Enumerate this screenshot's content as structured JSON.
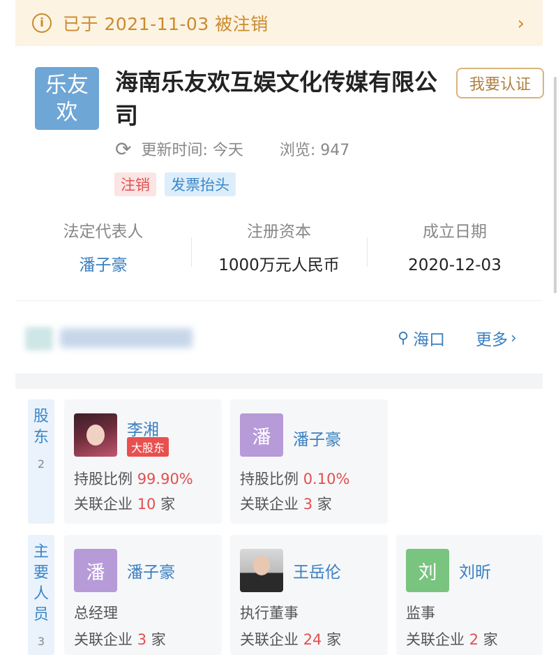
{
  "notice": {
    "text": "已于 2021-11-03 被注销",
    "info_icon": "i",
    "chevron": "›"
  },
  "company": {
    "logo_line1": "乐友",
    "logo_line2": "欢",
    "name": "海南乐友欢互娱文化传媒有限公司",
    "certify_label": "我要认证"
  },
  "meta": {
    "refresh_icon": "⟳",
    "updated": "更新时间: 今天",
    "views": "浏览: 947"
  },
  "tags": [
    "注销",
    "发票抬头"
  ],
  "basic_info": [
    {
      "label": "法定代表人",
      "value": "潘子豪"
    },
    {
      "label": "注册资本",
      "value": "1000万元人民币"
    },
    {
      "label": "成立日期",
      "value": "2020-12-03"
    }
  ],
  "location": {
    "pin_icon": "⚲",
    "city": "海口",
    "more_label": "更多",
    "more_chevron": "›"
  },
  "shareholders": {
    "side_label_1": "股",
    "side_label_2": "东",
    "count": "2",
    "items": [
      {
        "name": "李湘",
        "badge": "大股东",
        "ratio_label": "持股比例",
        "ratio": "99.90%",
        "assoc_label": "关联企业",
        "assoc_count": "10",
        "assoc_unit": "家"
      },
      {
        "avatar": "潘",
        "name": "潘子豪",
        "ratio_label": "持股比例",
        "ratio": "0.10%",
        "assoc_label": "关联企业",
        "assoc_count": "3",
        "assoc_unit": "家"
      }
    ]
  },
  "staff": {
    "side_label_1": "主",
    "side_label_2": "要",
    "side_label_3": "人",
    "side_label_4": "员",
    "count": "3",
    "items": [
      {
        "avatar": "潘",
        "name": "潘子豪",
        "role": "总经理",
        "assoc_label": "关联企业",
        "assoc_count": "3",
        "assoc_unit": "家"
      },
      {
        "name": "王岳伦",
        "role": "执行董事",
        "assoc_label": "关联企业",
        "assoc_count": "24",
        "assoc_unit": "家"
      },
      {
        "avatar": "刘",
        "name": "刘昕",
        "role": "监事",
        "assoc_label": "关联企业",
        "assoc_count": "2",
        "assoc_unit": "家"
      }
    ]
  },
  "colors": {
    "accent_blue": "#3a7fc0",
    "warning_orange": "#c98b2e",
    "alert_red": "#e05050"
  }
}
